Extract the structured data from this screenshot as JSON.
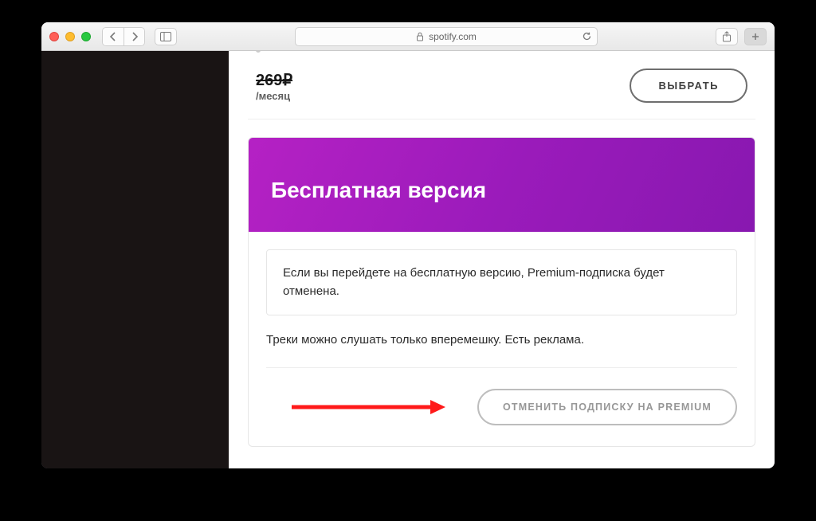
{
  "browser": {
    "address": "spotify.com"
  },
  "top_card": {
    "price_struck": "269₽",
    "period": "/месяц",
    "choose_label": "ВЫБРАТЬ"
  },
  "free_plan": {
    "title": "Бесплатная версия",
    "notice": "Если вы перейдете на бесплатную версию, Premium-подписка будет отменена.",
    "description": "Треки можно слушать только вперемешку. Есть реклама.",
    "cancel_label": "ОТМЕНИТЬ ПОДПИСКУ НА PREMIUM"
  }
}
